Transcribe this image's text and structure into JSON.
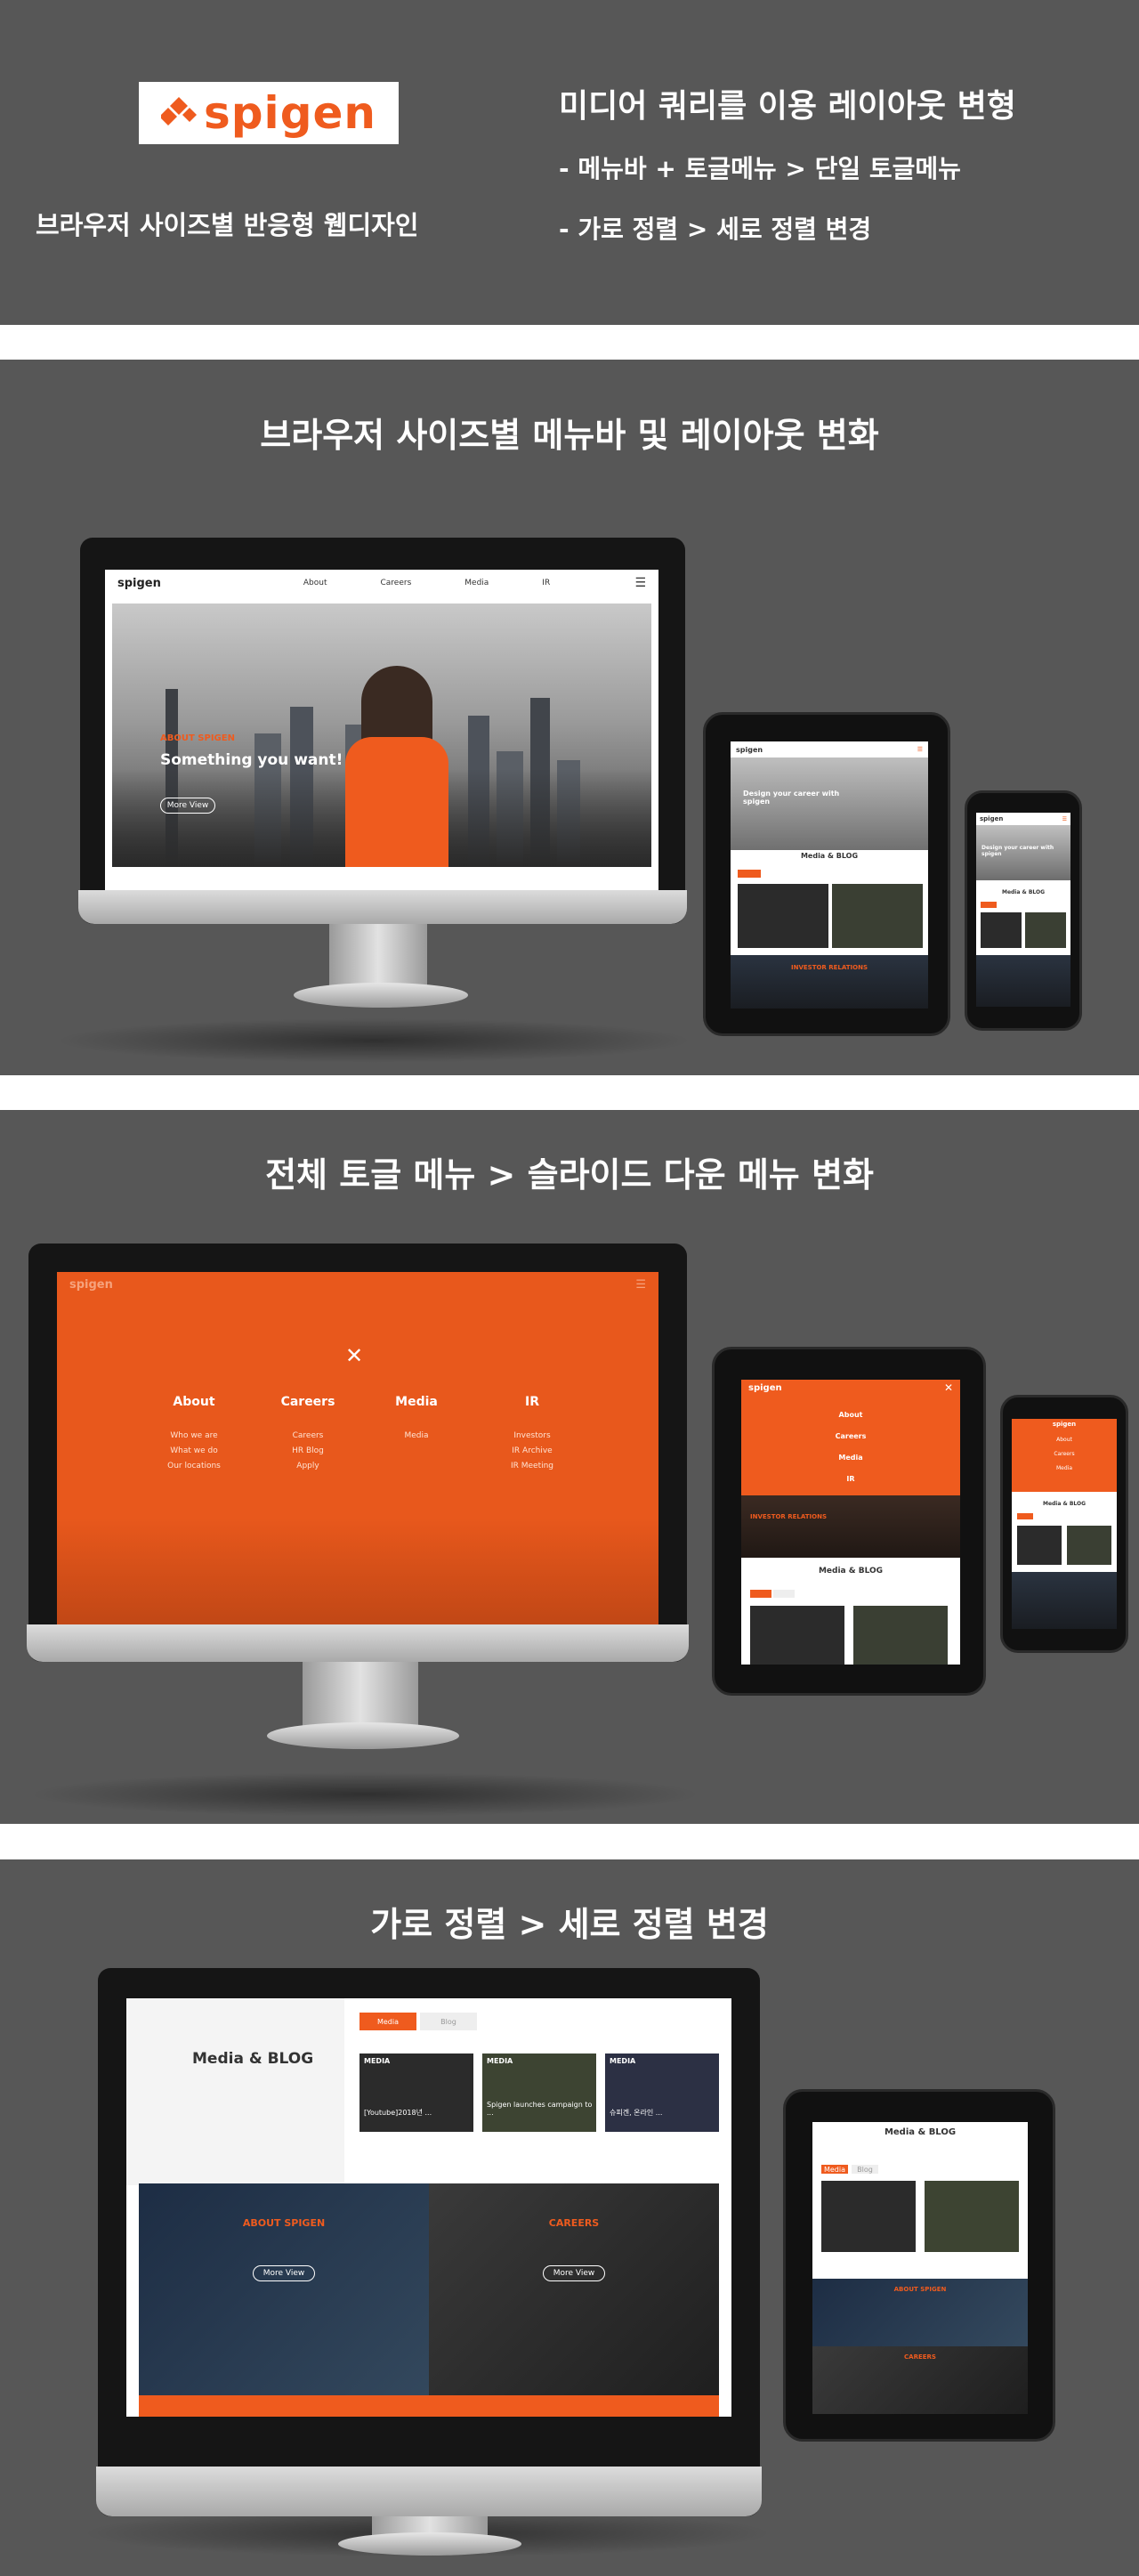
{
  "header": {
    "logo_text": "spigen",
    "tagline": "브라우저 사이즈별 반응형 웹디자인",
    "heading": "미디어 쿼리를 이용 레이아웃 변형",
    "bullet1": "- 메뉴바 + 토글메뉴 > 단일 토글메뉴",
    "bullet2": "- 가로 정렬 > 세로 정렬 변경"
  },
  "section2": {
    "title": "브라우저 사이즈별 메뉴바 및 레이아웃 변화"
  },
  "section3": {
    "title": "전체 토글 메뉴 > 슬라이드 다운 메뉴 변화"
  },
  "section4": {
    "title": "가로 정렬 > 세로 정렬 변경"
  },
  "desktop_site": {
    "logo": "spigen",
    "nav": [
      "About",
      "Careers",
      "Media",
      "IR"
    ],
    "hero_kicker": "ABOUT SPIGEN",
    "hero_title": "Something you want!",
    "more_view": "More View"
  },
  "menu_overlay": {
    "columns": [
      {
        "title": "About",
        "items": [
          "Who we are",
          "What we do",
          "Our locations"
        ]
      },
      {
        "title": "Careers",
        "items": [
          "Careers",
          "HR Blog",
          "Apply"
        ]
      },
      {
        "title": "Media",
        "items": [
          "Media"
        ]
      },
      {
        "title": "IR",
        "items": [
          "Investors",
          "IR Archive",
          "IR Meeting"
        ]
      }
    ],
    "tablet_items": [
      "About",
      "Careers",
      "Media",
      "IR"
    ],
    "phone_items": [
      "About",
      "Careers",
      "Media"
    ]
  },
  "tablet_site": {
    "hero_title": "Design your career with spigen",
    "section": "Media & BLOG",
    "kicker": "INVESTOR RELATIONS"
  },
  "phone_site": {
    "hero_title": "Design your career with spigen",
    "section": "Media & BLOG"
  },
  "media_blog": {
    "title": "Media & BLOG",
    "tabs": [
      "Media",
      "Blog"
    ],
    "card_tag": "MEDIA",
    "cards": [
      "[Youtube]2018년 ...",
      "Spigen launches campaign to ...",
      "슈피겐, 온라인 ..."
    ],
    "about_title": "ABOUT SPIGEN",
    "careers_title": "CAREERS",
    "more_view": "More View"
  },
  "colors": {
    "brand": "#ef5b1e",
    "panel_bg": "#575757"
  }
}
